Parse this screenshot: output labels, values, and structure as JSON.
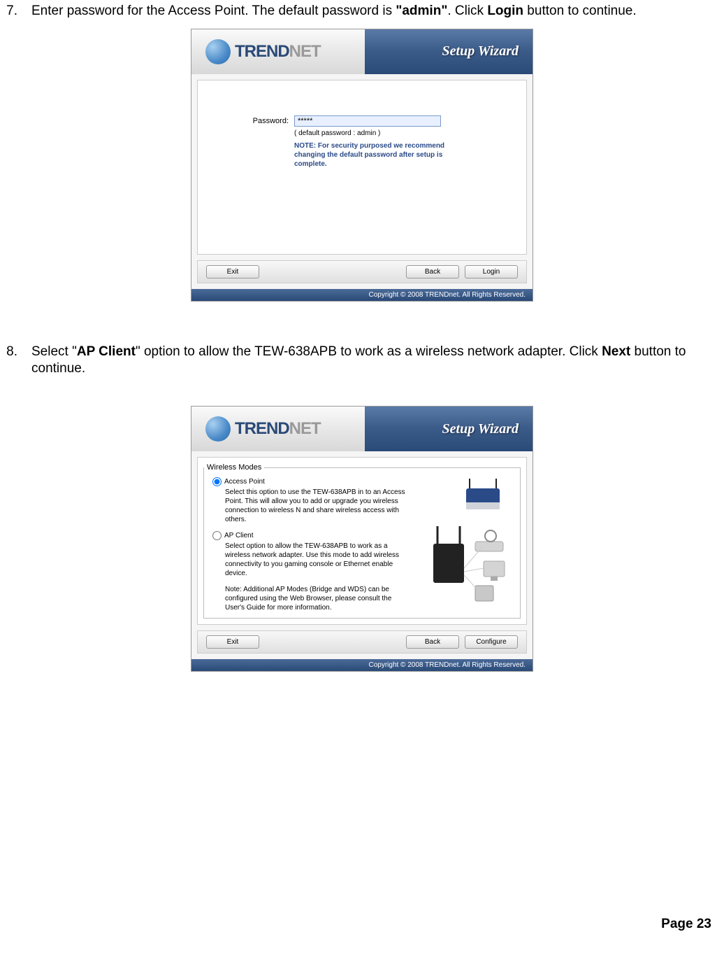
{
  "step7": {
    "num": "7.",
    "text_parts": {
      "p1": "Enter password for the Access Point. The default password is ",
      "bold1": "\"admin\"",
      "p2": ". Click ",
      "bold2": "Login",
      "p3": " button to continue."
    }
  },
  "step8": {
    "num": "8.",
    "text_parts": {
      "p1": "Select \"",
      "bold1": "AP Client",
      "p2": "\" option to allow the TEW-638APB to work as a wireless network adapter. Click ",
      "bold2": "Next",
      "p3": " button to continue."
    }
  },
  "wizard": {
    "brand_trend": "TREND",
    "brand_net": "NET",
    "title": "Setup Wizard",
    "copyright": "Copyright © 2008 TRENDnet. All Rights Reserved."
  },
  "password_screen": {
    "label": "Password:",
    "value": "*****",
    "hint": "( default password : admin )",
    "note": "NOTE: For security purposed we recommend changing the default password after setup is complete.",
    "buttons": {
      "exit": "Exit",
      "back": "Back",
      "login": "Login"
    }
  },
  "modes_screen": {
    "legend": "Wireless Modes",
    "ap": {
      "label": "Access Point",
      "desc": "Select this option to use the TEW-638APB in to an Access Point. This will allow you to add or upgrade you wireless connection to wireless N and share wireless access with others."
    },
    "client": {
      "label": "AP Client",
      "desc": "Select option to allow the TEW-638APB to work as a wireless network adapter. Use this mode to add wireless connectivity to you gaming console or Ethernet enable device."
    },
    "note": "Note: Additional AP Modes (Bridge and WDS) can be configured using the Web Browser, please consult the User's Guide for more information.",
    "buttons": {
      "exit": "Exit",
      "back": "Back",
      "configure": "Configure"
    }
  },
  "footer": {
    "page_label": "Page  23"
  }
}
